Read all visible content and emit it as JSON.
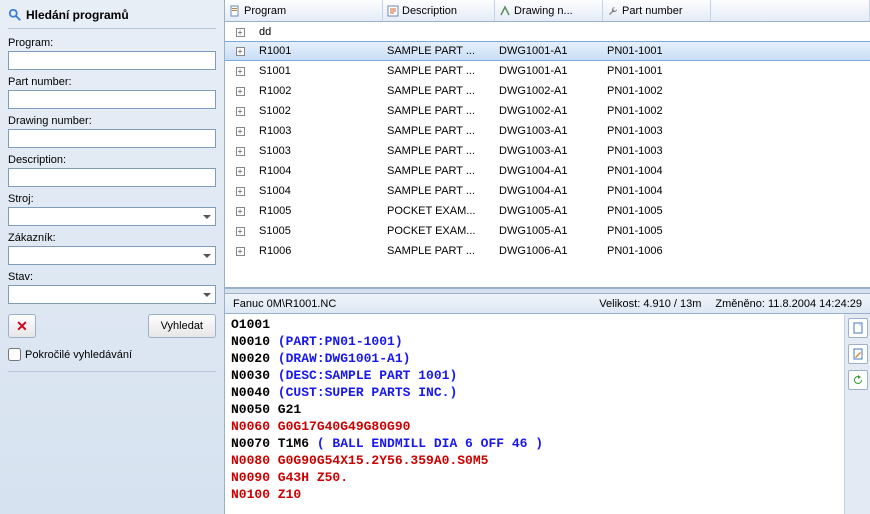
{
  "sidebar": {
    "title": "Hledání programů",
    "labels": {
      "program": "Program:",
      "partNumber": "Part number:",
      "drawingNumber": "Drawing number:",
      "description": "Description:",
      "stroj": "Stroj:",
      "zakaznik": "Zákazník:",
      "stav": "Stav:"
    },
    "searchBtn": "Vyhledat",
    "advanced": "Pokročilé vyhledávání"
  },
  "grid": {
    "headers": {
      "program": "Program",
      "description": "Description",
      "drawing": "Drawing n...",
      "part": "Part number"
    },
    "rows": [
      {
        "program": "dd",
        "description": "",
        "drawing": "",
        "part": "",
        "selected": false
      },
      {
        "program": "R1001",
        "description": "SAMPLE PART ...",
        "drawing": "DWG1001-A1",
        "part": "PN01-1001",
        "selected": true
      },
      {
        "program": "S1001",
        "description": "SAMPLE PART ...",
        "drawing": "DWG1001-A1",
        "part": "PN01-1001",
        "selected": false
      },
      {
        "program": "R1002",
        "description": "SAMPLE PART ...",
        "drawing": "DWG1002-A1",
        "part": "PN01-1002",
        "selected": false
      },
      {
        "program": "S1002",
        "description": "SAMPLE PART ...",
        "drawing": "DWG1002-A1",
        "part": "PN01-1002",
        "selected": false
      },
      {
        "program": "R1003",
        "description": "SAMPLE PART ...",
        "drawing": "DWG1003-A1",
        "part": "PN01-1003",
        "selected": false
      },
      {
        "program": "S1003",
        "description": "SAMPLE PART ...",
        "drawing": "DWG1003-A1",
        "part": "PN01-1003",
        "selected": false
      },
      {
        "program": "R1004",
        "description": "SAMPLE PART ...",
        "drawing": "DWG1004-A1",
        "part": "PN01-1004",
        "selected": false
      },
      {
        "program": "S1004",
        "description": "SAMPLE PART ...",
        "drawing": "DWG1004-A1",
        "part": "PN01-1004",
        "selected": false
      },
      {
        "program": "R1005",
        "description": "POCKET EXAM...",
        "drawing": "DWG1005-A1",
        "part": "PN01-1005",
        "selected": false
      },
      {
        "program": "S1005",
        "description": "POCKET EXAM...",
        "drawing": "DWG1005-A1",
        "part": "PN01-1005",
        "selected": false
      },
      {
        "program": "R1006",
        "description": "SAMPLE PART ...",
        "drawing": "DWG1006-A1",
        "part": "PN01-1006",
        "selected": false
      }
    ]
  },
  "status": {
    "path": "Fanuc 0M\\R1001.NC",
    "sizeLabel": "Velikost:",
    "size": "4.910 / 13m",
    "changedLabel": "Změněno:",
    "changed": "11.8.2004 14:24:29"
  },
  "code": [
    {
      "text": "O1001",
      "cls": "tok-black"
    },
    {
      "text": "N0010 ",
      "cls": "tok-black",
      "append": {
        "text": "(PART:PN01-1001)",
        "cls": "tok-blue"
      }
    },
    {
      "text": "N0020 ",
      "cls": "tok-black",
      "append": {
        "text": "(DRAW:DWG1001-A1)",
        "cls": "tok-blue"
      }
    },
    {
      "text": "N0030 ",
      "cls": "tok-black",
      "append": {
        "text": "(DESC:SAMPLE PART 1001)",
        "cls": "tok-blue"
      }
    },
    {
      "text": "N0040 ",
      "cls": "tok-black",
      "append": {
        "text": "(CUST:SUPER PARTS INC.)",
        "cls": "tok-blue"
      }
    },
    {
      "text": "N0050 G21",
      "cls": "tok-black"
    },
    {
      "text": "N0060 G0G17G40G49G80G90",
      "cls": "tok-red"
    },
    {
      "text": "N0070 T1M6 ",
      "cls": "tok-black",
      "append": {
        "text": "( BALL ENDMILL DIA 6 OFF 46 )",
        "cls": "tok-blue"
      }
    },
    {
      "text": "N0080 G0G90G54X15.2Y56.359A0.S0M5",
      "cls": "tok-red"
    },
    {
      "text": "N0090 G43H Z50.",
      "cls": "tok-red"
    },
    {
      "text": "N0100 Z10",
      "cls": "tok-red"
    }
  ]
}
